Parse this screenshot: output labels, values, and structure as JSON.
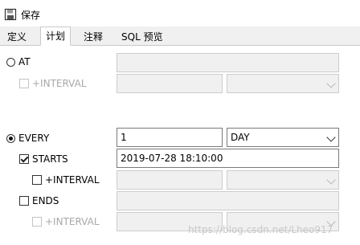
{
  "toolbar": {
    "save_label": "保存"
  },
  "tabs": [
    {
      "label": "定义",
      "active": false
    },
    {
      "label": "计划",
      "active": true
    },
    {
      "label": "注释",
      "active": false
    },
    {
      "label": "SQL 预览",
      "active": false
    }
  ],
  "schedule": {
    "at": {
      "label": "AT",
      "selected": false,
      "value": ""
    },
    "at_interval": {
      "label": "+INTERVAL",
      "checked": false,
      "value": "",
      "unit": ""
    },
    "every": {
      "label": "EVERY",
      "selected": true,
      "value": "1",
      "unit": "DAY"
    },
    "starts": {
      "label": "STARTS",
      "checked": true,
      "value": "2019-07-28 18:10:00"
    },
    "starts_interval": {
      "label": "+INTERVAL",
      "checked": false,
      "value": "",
      "unit": ""
    },
    "ends": {
      "label": "ENDS",
      "checked": false,
      "value": ""
    },
    "ends_interval": {
      "label": "+INTERVAL",
      "checked": false,
      "value": "",
      "unit": ""
    }
  },
  "watermark": "https://blog.csdn.net/Lheo917",
  "colors": {
    "disabled_text": "#a8a8a8",
    "tabbar_bg": "#f0f0f0",
    "disabled_field_bg": "#f0f0f0"
  },
  "icons": {
    "save": "floppy-disk-icon",
    "dropdown": "chevron-down-icon"
  }
}
